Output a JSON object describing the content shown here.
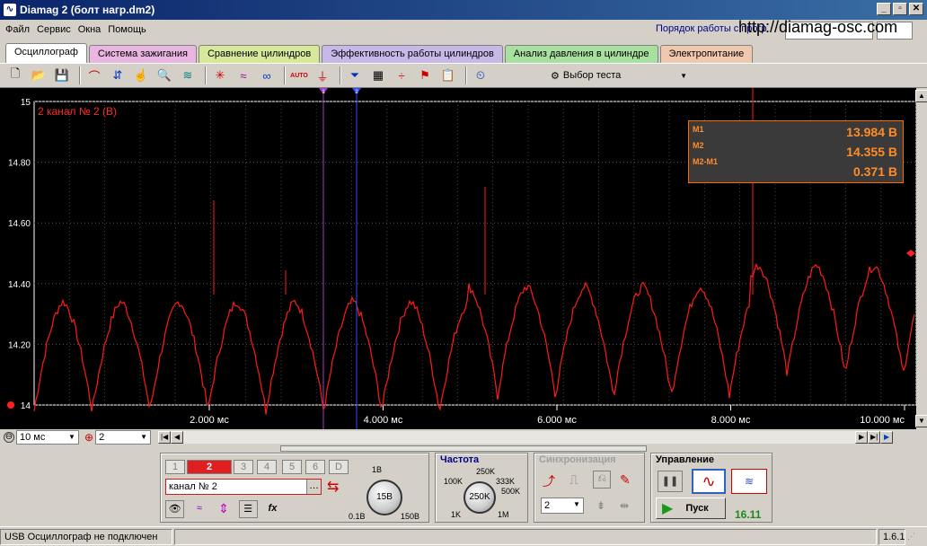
{
  "window": {
    "title": "Diamag 2 (болт нагр.dm2)"
  },
  "menu": [
    "Файл",
    "Сервис",
    "Окна",
    "Помощь"
  ],
  "header": {
    "order_link": "Порядок работы с прогр",
    "url": "http://diamag-osc.com"
  },
  "tabs": [
    {
      "label": "Осциллограф",
      "color": "#ffffff"
    },
    {
      "label": "Система зажигания",
      "color": "#e8b6e0"
    },
    {
      "label": "Сравнение цилиндров",
      "color": "#d8e89a"
    },
    {
      "label": "Эффективность работы цилиндров",
      "color": "#c8b8e8"
    },
    {
      "label": "Анализ давления в цилиндре",
      "color": "#a8e0a0"
    },
    {
      "label": "Электропитание",
      "color": "#f0c8b0"
    }
  ],
  "toolbar": {
    "test_select": "Выбор теста",
    "auto_label": "AUTO"
  },
  "scope": {
    "channel_label": "2 канал № 2 (В)",
    "trace_color": "#ff1a1a",
    "y_ticks": [
      "15",
      "14.80",
      "14.60",
      "14.40",
      "14.20",
      "14"
    ],
    "x_ticks": [
      "2.000 мс",
      "4.000 мс",
      "6.000 мс",
      "8.000 мс",
      "10.000 мс"
    ],
    "marker1_label": "1",
    "marker2_label": "2",
    "readout": [
      {
        "label": "M1",
        "value": "13.984 В"
      },
      {
        "label": "M2",
        "value": "14.355 В"
      },
      {
        "label": "M2-M1",
        "value": "0.371 В"
      }
    ]
  },
  "hbar": {
    "timebase": "10 мс",
    "channel": "2"
  },
  "channels": {
    "buttons": [
      "1",
      "2",
      "3",
      "4",
      "5",
      "6",
      "D"
    ],
    "active": "2",
    "name": "канал № 2",
    "volt_knob": {
      "value": "15В",
      "min": "0.1В",
      "max": "150В",
      "top": "1В"
    }
  },
  "frequency": {
    "title": "Частота",
    "value": "250K",
    "labels": {
      "l1": "100K",
      "l2": "250K",
      "l3": "333K",
      "l4": "500K",
      "l5": "1K",
      "l6": "1M"
    }
  },
  "sync": {
    "title": "Синхронизация",
    "value": "2"
  },
  "control": {
    "title": "Управление",
    "start": "Пуск",
    "version": "16.11"
  },
  "status": {
    "message": "USB Осциллограф не подключен",
    "version": "1.6.1"
  }
}
